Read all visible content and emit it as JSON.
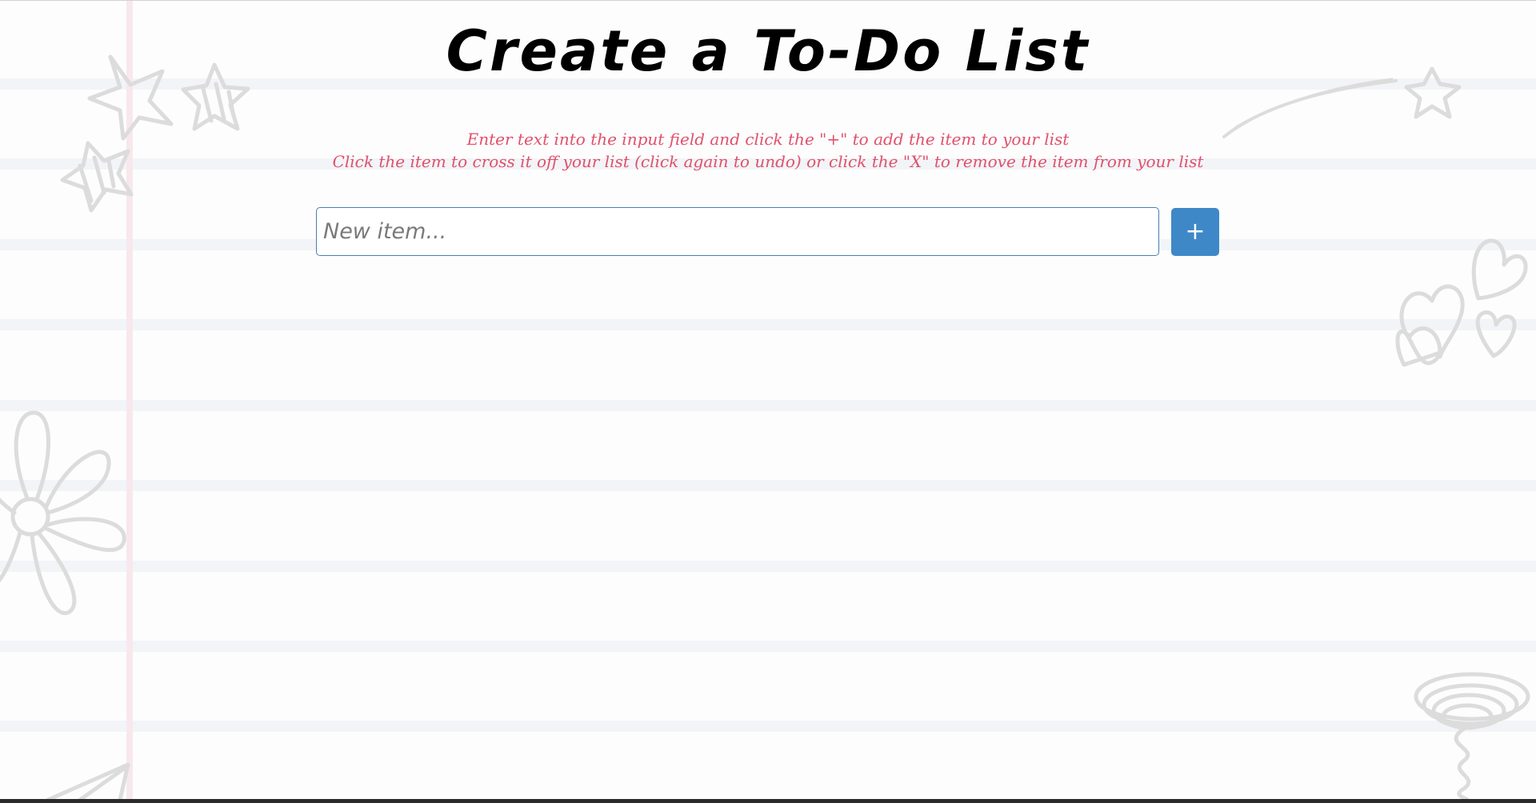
{
  "page": {
    "title": "Create a To-Do List",
    "instructions": [
      "Enter text into the input field and click the \"+\" to add the item to your list",
      "Click the item to cross it off your list (click again to undo) or click the \"X\" to remove the item from your list"
    ]
  },
  "form": {
    "input_value": "",
    "input_placeholder": "New item...",
    "add_button_label": "+"
  },
  "doodles": [
    "star-doodle-icon",
    "flower-doodle-icon",
    "heart-doodle-icon",
    "shooting-star-doodle-icon",
    "spiral-doodle-icon",
    "paper-plane-doodle-icon"
  ],
  "colors": {
    "instructions": "#e0516b",
    "accent": "#3e88c8",
    "input_border": "#4a7fb3"
  }
}
